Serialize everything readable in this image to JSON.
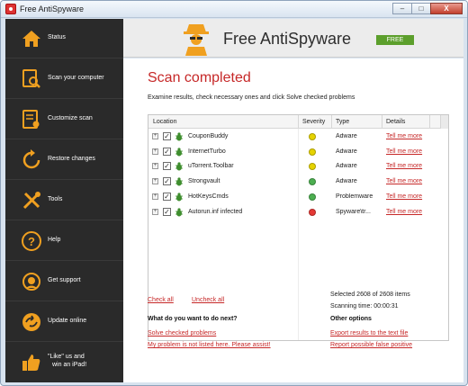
{
  "window": {
    "title": "Free AntiSpyware",
    "controls": {
      "minimize": "–",
      "maximize": "□",
      "close": "X"
    }
  },
  "sidebar": {
    "items": [
      {
        "label": "Status",
        "icon": "home-icon"
      },
      {
        "label": "Scan your computer",
        "icon": "scan-magnifier-icon"
      },
      {
        "label": "Customize scan",
        "icon": "customize-scan-icon"
      },
      {
        "label": "Restore changes",
        "icon": "restore-icon"
      },
      {
        "label": "Tools",
        "icon": "tools-icon"
      },
      {
        "label": "Help",
        "icon": "help-icon"
      },
      {
        "label": "Get support",
        "icon": "support-icon"
      },
      {
        "label": "Update online",
        "icon": "update-icon"
      },
      {
        "label_line1": "\"Like\" us and",
        "label_line2": "win an iPad!",
        "icon": "like-icon"
      }
    ],
    "accent": "#f0a020"
  },
  "header": {
    "app_name": "Free AntiSpyware",
    "badge": "FREE",
    "badge_color": "#5c9f2c"
  },
  "main": {
    "title": "Scan completed",
    "description": "Examine results, check necessary ones and click Solve checked problems",
    "table": {
      "columns": {
        "location": "Location",
        "severity": "Severity",
        "type": "Type",
        "details": "Details"
      },
      "rows": [
        {
          "name": "CouponBuddy",
          "severity": "medium",
          "severity_color": "#e6d300",
          "type": "Adware",
          "details": "Tell me more"
        },
        {
          "name": "InternetTurbo",
          "severity": "medium",
          "severity_color": "#e6d300",
          "type": "Adware",
          "details": "Tell me more"
        },
        {
          "name": "uTorrent.Toolbar",
          "severity": "medium",
          "severity_color": "#e6d300",
          "type": "Adware",
          "details": "Tell me more"
        },
        {
          "name": "Strongvault",
          "severity": "low",
          "severity_color": "#4caf50",
          "type": "Adware",
          "details": "Tell me more"
        },
        {
          "name": "HotKeysCmds",
          "severity": "low",
          "severity_color": "#4caf50",
          "type": "Problemware",
          "details": "Tell me more"
        },
        {
          "name": "Autorun.inf infected",
          "severity": "high",
          "severity_color": "#e53935",
          "type": "Spyware\\tr...",
          "details": "Tell me more"
        }
      ]
    },
    "check_all": "Check all",
    "uncheck_all": "Uncheck all",
    "selected_text": "Selected 2608 of 2608 items",
    "scanning_time": "Scanning time: 00:00:31",
    "next_heading": "What do you want to do next?",
    "solve_link": "Solve checked problems",
    "not_listed_link": "My problem is not listed here. Please assist!",
    "other_heading": "Other options",
    "export_link": "Export results to the text file",
    "report_link": "Report possible false positive"
  }
}
